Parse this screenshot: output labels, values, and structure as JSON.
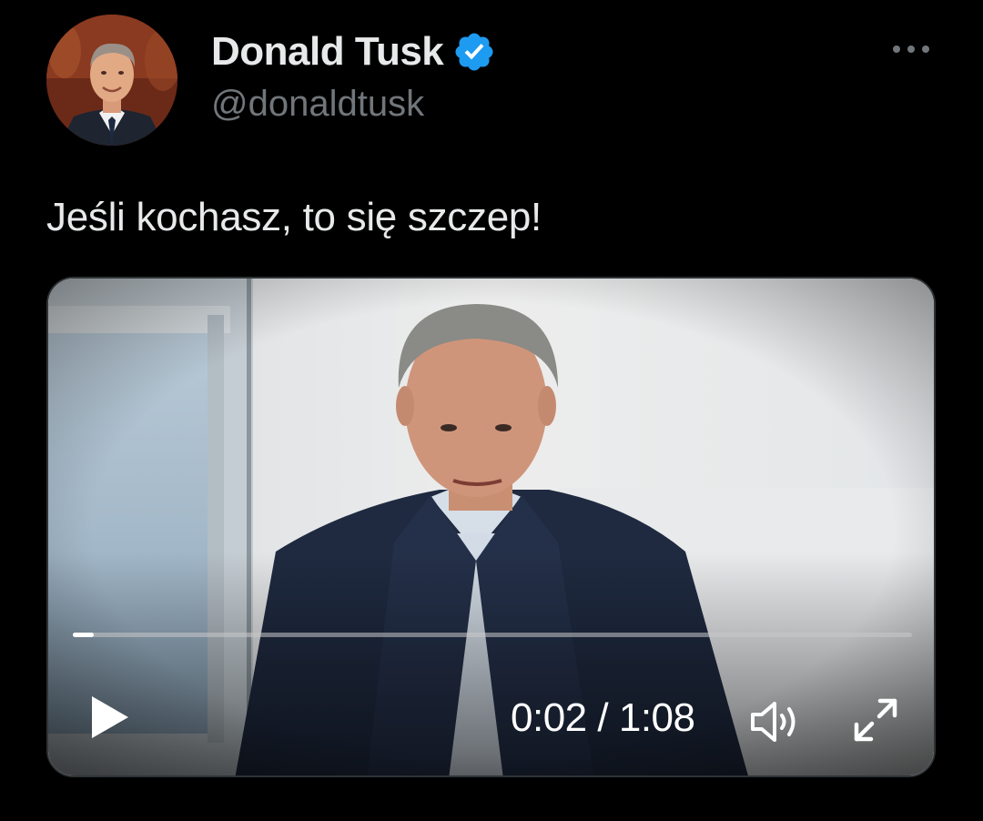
{
  "author": {
    "display_name": "Donald Tusk",
    "handle": "@donaldtusk",
    "verified": true,
    "verified_color": "#1d9bf0"
  },
  "post": {
    "text": "Jeśli kochasz, to się szczep!"
  },
  "video": {
    "current_time": "0:02",
    "separator": "/",
    "duration": "1:08",
    "progress_fraction": 0.025,
    "play_icon": "play-icon",
    "volume_icon": "volume-icon",
    "fullscreen_icon": "fullscreen-icon"
  },
  "menu": {
    "icon": "more-options-icon"
  },
  "colors": {
    "background": "#000000",
    "text_primary": "#e7e9ea",
    "text_secondary": "#71767b",
    "accent": "#1d9bf0"
  }
}
